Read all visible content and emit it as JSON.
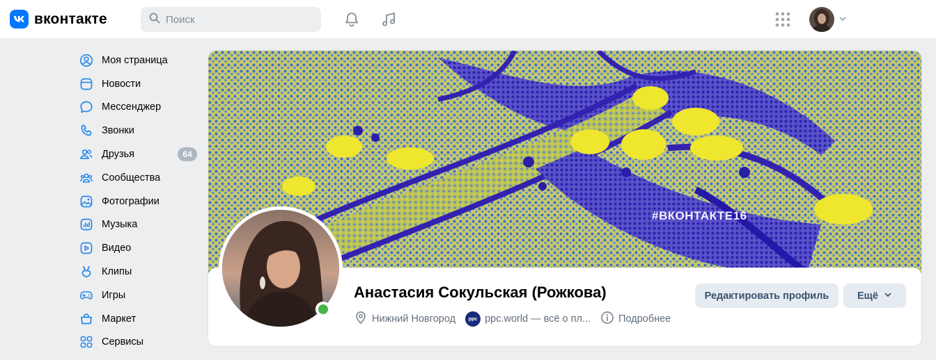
{
  "header": {
    "logo_text": "вконтакте",
    "search_placeholder": "Поиск"
  },
  "sidebar": {
    "items": [
      {
        "label": "Моя страница",
        "icon": "user-circle-icon"
      },
      {
        "label": "Новости",
        "icon": "news-icon"
      },
      {
        "label": "Мессенджер",
        "icon": "message-icon"
      },
      {
        "label": "Звонки",
        "icon": "phone-icon"
      },
      {
        "label": "Друзья",
        "icon": "friends-icon",
        "badge": "64"
      },
      {
        "label": "Сообщества",
        "icon": "communities-icon"
      },
      {
        "label": "Фотографии",
        "icon": "photo-icon"
      },
      {
        "label": "Музыка",
        "icon": "music-icon"
      },
      {
        "label": "Видео",
        "icon": "video-icon"
      },
      {
        "label": "Клипы",
        "icon": "clips-icon"
      },
      {
        "label": "Игры",
        "icon": "gamepad-icon"
      },
      {
        "label": "Маркет",
        "icon": "market-icon"
      },
      {
        "label": "Сервисы",
        "icon": "services-icon"
      }
    ]
  },
  "profile": {
    "cover_tag": "#ВКОНТАКТЕ16",
    "name": "Анастасия Сокульская (Рожкова)",
    "city": "Нижний Новгород",
    "job_badge": "ppc",
    "job": "ppc.world — всё о пл...",
    "details": "Подробнее",
    "edit_button": "Редактировать профиль",
    "more_button": "Ещё"
  },
  "colors": {
    "accent": "#0077ff",
    "online": "#4bb34b",
    "button_bg": "#e5ebf1",
    "page_bg": "#edeef0"
  }
}
